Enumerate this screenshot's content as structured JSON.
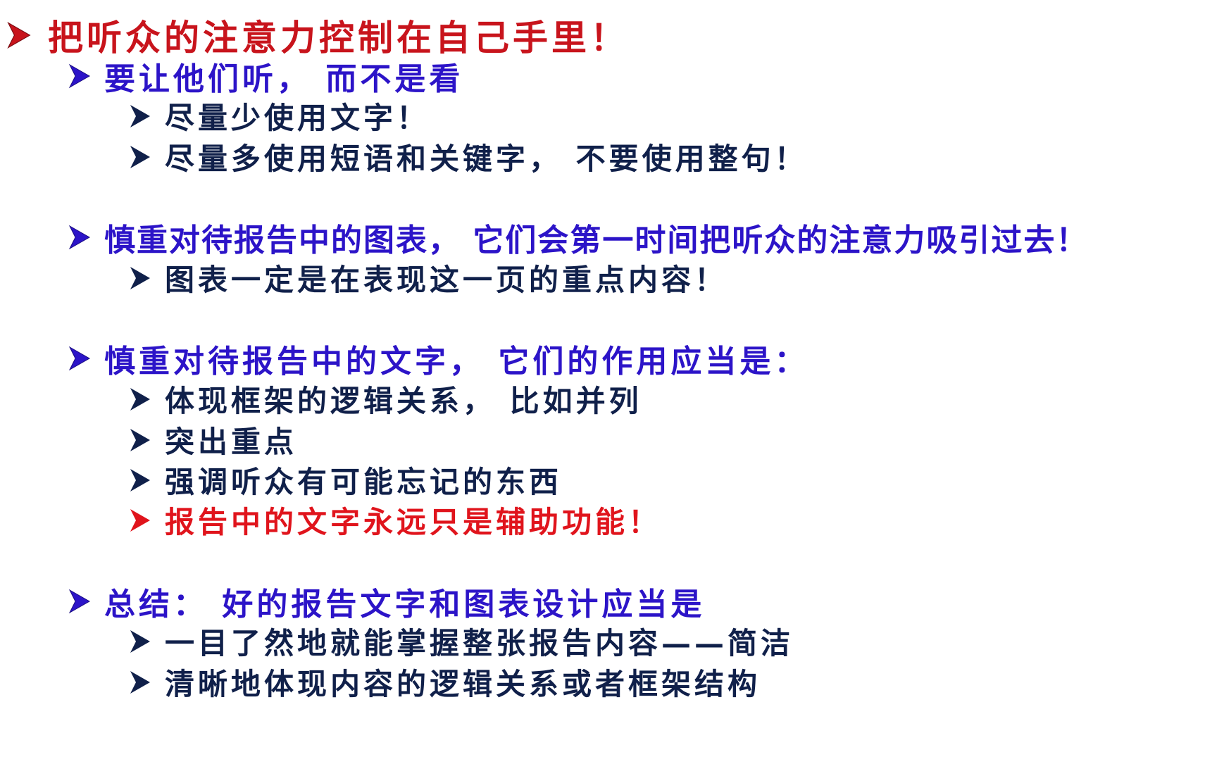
{
  "colors": {
    "title_red": "#c8141c",
    "heading_blue": "#2c14c8",
    "body_navy": "#10204a",
    "emphasis_red": "#e0141c"
  },
  "bullet_icon": "arrowhead-bullet-icon",
  "title": "把听众的注意力控制在自己手里！",
  "sections": [
    {
      "heading": "要让他们听， 而不是看",
      "items": [
        "尽量少使用文字！",
        "尽量多使用短语和关键字， 不要使用整句！"
      ]
    },
    {
      "heading": "慎重对待报告中的图表， 它们会第一时间把听众的注意力吸引过去！",
      "items": [
        "图表一定是在表现这一页的重点内容！"
      ]
    },
    {
      "heading": "慎重对待报告中的文字， 它们的作用应当是：",
      "items": [
        "体现框架的逻辑关系， 比如并列",
        "突出重点",
        "强调听众有可能忘记的东西",
        "报告中的文字永远只是辅助功能！"
      ]
    },
    {
      "heading": "总结： 好的报告文字和图表设计应当是",
      "items": [
        "一目了然地就能掌握整张报告内容——简洁",
        "清晰地体现内容的逻辑关系或者框架结构"
      ]
    }
  ]
}
